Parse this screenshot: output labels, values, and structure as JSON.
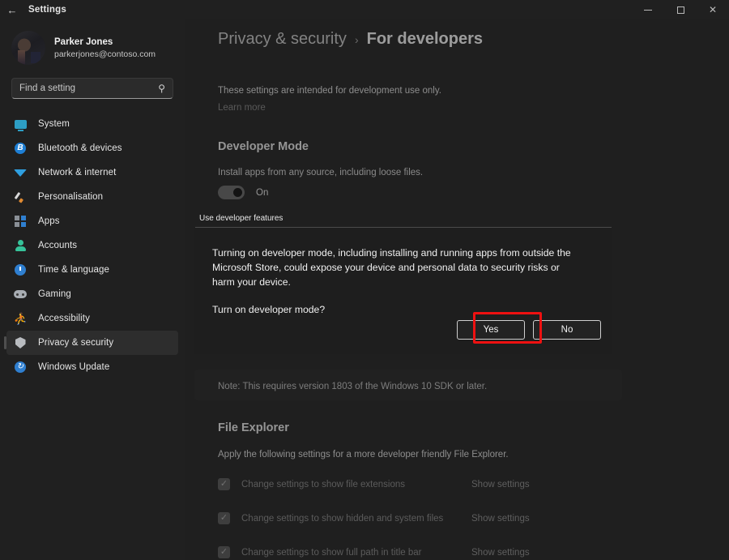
{
  "titlebar": {
    "back_icon": "back-arrow-icon",
    "title": "Settings",
    "minimize": "–",
    "maximize": "",
    "close": "✕"
  },
  "sidebar": {
    "profile": {
      "name": "Parker Jones",
      "email": "parkerjones@contoso.com"
    },
    "search": {
      "placeholder": "Find a setting",
      "value": "",
      "icon": "search-icon"
    },
    "items": [
      {
        "label": "System",
        "icon": "monitor-icon",
        "selected": false
      },
      {
        "label": "Bluetooth & devices",
        "icon": "bluetooth-icon",
        "selected": false
      },
      {
        "label": "Network & internet",
        "icon": "wifi-icon",
        "selected": false
      },
      {
        "label": "Personalisation",
        "icon": "paintbrush-icon",
        "selected": false
      },
      {
        "label": "Apps",
        "icon": "apps-grid-icon",
        "selected": false
      },
      {
        "label": "Accounts",
        "icon": "person-icon",
        "selected": false
      },
      {
        "label": "Time & language",
        "icon": "clock-icon",
        "selected": false
      },
      {
        "label": "Gaming",
        "icon": "gamepad-icon",
        "selected": false
      },
      {
        "label": "Accessibility",
        "icon": "accessibility-icon",
        "selected": false
      },
      {
        "label": "Privacy & security",
        "icon": "shield-icon",
        "selected": true
      },
      {
        "label": "Windows Update",
        "icon": "update-refresh-icon",
        "selected": false
      }
    ]
  },
  "content": {
    "breadcrumb": {
      "parent": "Privacy & security",
      "separator": "›",
      "current": "For developers"
    },
    "intro": "These settings are intended for development use only.",
    "learn_more": "Learn more",
    "developer_mode": {
      "title": "Developer Mode",
      "description": "Install apps from any source, including loose files.",
      "toggle_state": "On"
    },
    "note": "Note: This requires version 1803 of the Windows 10 SDK or later.",
    "file_explorer": {
      "title": "File Explorer",
      "description": "Apply the following settings for a more developer friendly File Explorer.",
      "rows": [
        {
          "label": "Change settings to show file extensions",
          "checked": true,
          "action": "Show settings"
        },
        {
          "label": "Change settings to show hidden and system files",
          "checked": true,
          "action": "Show settings"
        },
        {
          "label": "Change settings to show full path in title bar",
          "checked": true,
          "action": "Show settings"
        }
      ]
    }
  },
  "dialog": {
    "header": "Use developer features",
    "body": "Turning on developer mode, including installing and running apps from outside the Microsoft Store, could expose your device and personal data to security risks or harm your device.",
    "question": "Turn on developer mode?",
    "confirm_label": "Yes",
    "dismiss_label": "No"
  },
  "annotation": {
    "highlight_color": "#ee1111",
    "target": "Yes"
  }
}
